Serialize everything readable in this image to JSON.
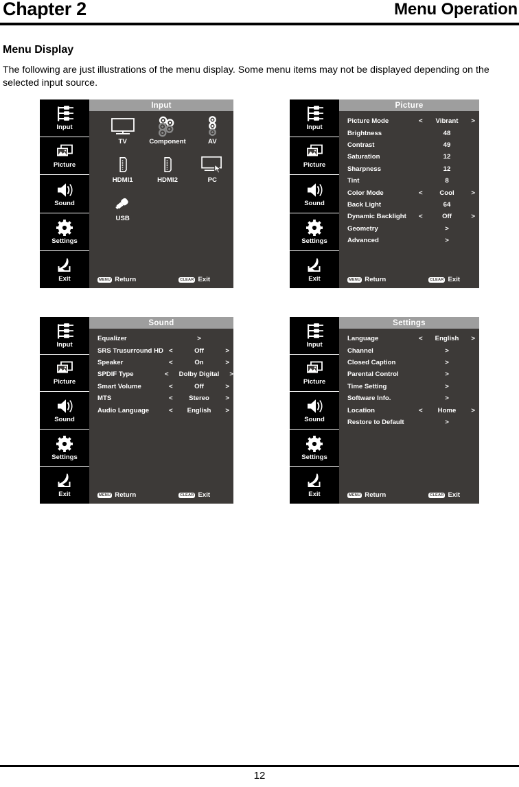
{
  "header": {
    "chapter": "Chapter 2",
    "section": "Menu Operation"
  },
  "intro": {
    "subhead": "Menu Display",
    "body": "The following are just illustrations of the menu display. Some menu items may not be displayed depending on the selected input source."
  },
  "sidebar": {
    "items": [
      {
        "label": "Input",
        "icon": "av-jacks-icon"
      },
      {
        "label": "Picture",
        "icon": "picture-frames-icon"
      },
      {
        "label": "Sound",
        "icon": "speaker-icon"
      },
      {
        "label": "Settings",
        "icon": "gear-icon"
      },
      {
        "label": "Exit",
        "icon": "exit-arrow-icon"
      }
    ]
  },
  "footer_keys": {
    "menu_key": "MENU",
    "return_label": "Return",
    "clear_key": "CLEAR",
    "exit_label": "Exit"
  },
  "panels": {
    "input": {
      "title": "Input",
      "sources": [
        {
          "label": "TV",
          "icon": "tv-screen-icon"
        },
        {
          "label": "Component",
          "icon": "component-jacks-icon"
        },
        {
          "label": "AV",
          "icon": "av-rca-icon"
        },
        {
          "label": "HDMI1",
          "icon": "hdmi-connector-icon"
        },
        {
          "label": "HDMI2",
          "icon": "hdmi-connector-icon"
        },
        {
          "label": "PC",
          "icon": "pc-monitor-icon"
        },
        {
          "label": "USB",
          "icon": "usb-plug-icon"
        }
      ]
    },
    "picture": {
      "title": "Picture",
      "rows": [
        {
          "label": "Picture Mode",
          "value": "Vibrant",
          "arrows": true
        },
        {
          "label": "Brightness",
          "value": "48",
          "arrows": false
        },
        {
          "label": "Contrast",
          "value": "49",
          "arrows": false
        },
        {
          "label": "Saturation",
          "value": "12",
          "arrows": false
        },
        {
          "label": "Sharpness",
          "value": "12",
          "arrows": false
        },
        {
          "label": "Tint",
          "value": "8",
          "arrows": false
        },
        {
          "label": "Color Mode",
          "value": "Cool",
          "arrows": true
        },
        {
          "label": "Back Light",
          "value": "64",
          "arrows": false
        },
        {
          "label": "Dynamic Backlight",
          "value": "Off",
          "arrows": true
        },
        {
          "label": "Geometry",
          "value": ">",
          "arrows": false
        },
        {
          "label": "Advanced",
          "value": ">",
          "arrows": false
        }
      ]
    },
    "sound": {
      "title": "Sound",
      "rows": [
        {
          "label": "Equalizer",
          "value": ">",
          "arrows": false
        },
        {
          "label": "SRS Trusurround HD",
          "value": "Off",
          "arrows": true
        },
        {
          "label": "Speaker",
          "value": "On",
          "arrows": true
        },
        {
          "label": "SPDIF Type",
          "value": "Dolby Digital",
          "arrows": true
        },
        {
          "label": "Smart Volume",
          "value": "Off",
          "arrows": true
        },
        {
          "label": "MTS",
          "value": "Stereo",
          "arrows": true
        },
        {
          "label": "Audio Language",
          "value": "English",
          "arrows": true
        }
      ]
    },
    "settings": {
      "title": "Settings",
      "rows": [
        {
          "label": "Language",
          "value": "English",
          "arrows": true
        },
        {
          "label": "Channel",
          "value": ">",
          "arrows": false
        },
        {
          "label": "Closed Caption",
          "value": ">",
          "arrows": false
        },
        {
          "label": "Parental Control",
          "value": ">",
          "arrows": false
        },
        {
          "label": "Time Setting",
          "value": ">",
          "arrows": false
        },
        {
          "label": "Software Info.",
          "value": ">",
          "arrows": false
        },
        {
          "label": "Location",
          "value": "Home",
          "arrows": true
        },
        {
          "label": "Restore to Default",
          "value": ">",
          "arrows": false
        }
      ]
    }
  },
  "arrows": {
    "left": "<",
    "right": ">"
  },
  "page_number": "12",
  "colors": {
    "titlebar": "#9e9e9e",
    "panel_body": "#3d3a38",
    "sidebar": "#000000",
    "text": "#ffffff",
    "icon_dim": "#8a8a8a"
  }
}
